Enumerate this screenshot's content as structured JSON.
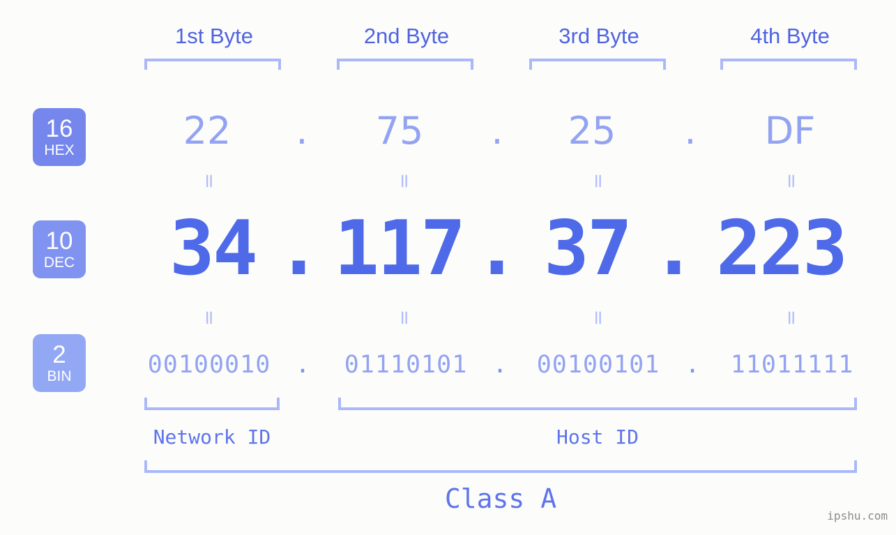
{
  "header": {
    "byte_labels": [
      "1st Byte",
      "2nd Byte",
      "3rd Byte",
      "4th Byte"
    ]
  },
  "bases": [
    {
      "number": "16",
      "name": "HEX",
      "color": "#7587ed"
    },
    {
      "number": "10",
      "name": "DEC",
      "color": "#8093f0"
    },
    {
      "number": "2",
      "name": "BIN",
      "color": "#93a8f4"
    }
  ],
  "rows": {
    "hex": {
      "octets": [
        "22",
        "75",
        "25",
        "DF"
      ],
      "separator": ".",
      "color": "#93a3f2"
    },
    "dec": {
      "octets": [
        "34",
        "117",
        "37",
        "223"
      ],
      "separator": ".",
      "color": "#4f6ae8"
    },
    "bin": {
      "octets": [
        "00100010",
        "01110101",
        "00100101",
        "11011111"
      ],
      "separator": ".",
      "color": "#93a3f2"
    }
  },
  "equality_marks": {
    "symbol": "=",
    "color": "#b2bdfb"
  },
  "segments": {
    "network_id": "Network ID",
    "host_id": "Host ID",
    "class": "Class A"
  },
  "watermark": "ipshu.com",
  "theme": {
    "background": "#fcfdfa",
    "bracket": "#aab8fa",
    "byte_label": "#4f63e0",
    "segment_label": "#5d74ec"
  }
}
